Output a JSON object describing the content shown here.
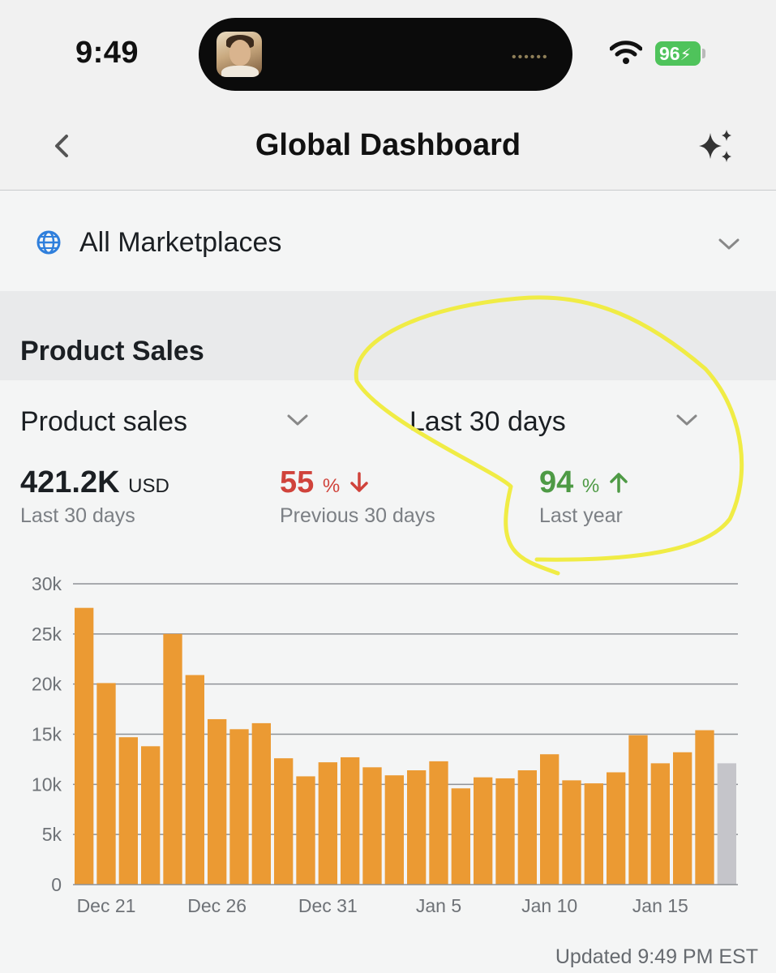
{
  "status_bar": {
    "time": "9:49",
    "battery": "96"
  },
  "nav": {
    "title": "Global Dashboard"
  },
  "marketplace": {
    "label": "All Marketplaces"
  },
  "section": {
    "title": "Product Sales"
  },
  "filters": {
    "metric": "Product sales",
    "period": "Last 30 days"
  },
  "stats": [
    {
      "value": "421.2K",
      "unit": "USD",
      "caption": "Last 30 days",
      "color": "#1b1f23"
    },
    {
      "value": "55",
      "unit": "%",
      "caption": "Previous 30 days",
      "color": "#d0433b",
      "trend": "down"
    },
    {
      "value": "94",
      "unit": "%",
      "caption": "Last year",
      "color": "#4e9a45",
      "trend": "up"
    }
  ],
  "chart_data": {
    "type": "bar",
    "ylim": [
      0,
      30000
    ],
    "y_ticks": [
      0,
      5000,
      10000,
      15000,
      20000,
      25000,
      30000
    ],
    "y_tick_labels": [
      "0",
      "5k",
      "10k",
      "15k",
      "20k",
      "25k",
      "30k"
    ],
    "x_tick_labels": [
      "Dec 21",
      "Dec 26",
      "Dec 31",
      "Jan 5",
      "Jan 10",
      "Jan 15"
    ],
    "x_tick_indices": [
      1,
      6,
      11,
      16,
      21,
      26
    ],
    "values": [
      27600,
      20100,
      14700,
      13800,
      25000,
      20900,
      16500,
      15500,
      16100,
      12600,
      10800,
      12200,
      12700,
      11700,
      10900,
      11400,
      12300,
      9600,
      10700,
      10600,
      11400,
      13000,
      10400,
      10100,
      11200,
      14900,
      12100,
      13200,
      15400,
      12100
    ],
    "bar_colors": [
      "#eb9a33",
      "#eb9a33",
      "#eb9a33",
      "#eb9a33",
      "#eb9a33",
      "#eb9a33",
      "#eb9a33",
      "#eb9a33",
      "#eb9a33",
      "#eb9a33",
      "#eb9a33",
      "#eb9a33",
      "#eb9a33",
      "#eb9a33",
      "#eb9a33",
      "#eb9a33",
      "#eb9a33",
      "#eb9a33",
      "#eb9a33",
      "#eb9a33",
      "#eb9a33",
      "#eb9a33",
      "#eb9a33",
      "#eb9a33",
      "#eb9a33",
      "#eb9a33",
      "#eb9a33",
      "#eb9a33",
      "#eb9a33",
      "#c5c5ca"
    ],
    "grid": true
  },
  "footer": {
    "updated": "Updated 9:49 PM EST"
  },
  "colors": {
    "accent_bar": "#eb9a33",
    "partial_bar": "#c5c5ca",
    "annotation": "#f0ec45",
    "globe": "#2f7fdc"
  }
}
